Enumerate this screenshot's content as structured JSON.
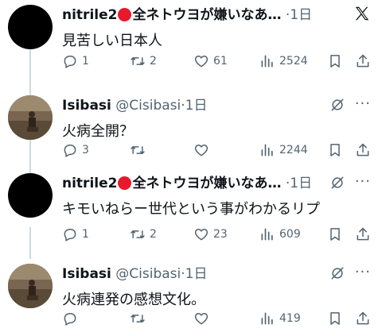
{
  "tweets": [
    {
      "name": "nitrile2",
      "name_suffix": "全ネトウヨが嫌いなあ…",
      "handle": "",
      "time": "1日",
      "text": "見苦しい日本人",
      "reply_count": "1",
      "retweet_count": "2",
      "like_count": "61",
      "view_count": "2524"
    },
    {
      "name": "Isibasi",
      "name_suffix": "",
      "handle": "@Cisibasi",
      "time": "1日",
      "text": "火病全開？",
      "reply_count": "3",
      "retweet_count": "",
      "like_count": "",
      "view_count": "2244"
    },
    {
      "name": "nitrile2",
      "name_suffix": "全ネトウヨが嫌いなあ…",
      "handle": "",
      "time": "1日",
      "text": "キモいねらー世代という事がわかるリプ",
      "reply_count": "1",
      "retweet_count": "2",
      "like_count": "23",
      "view_count": "609"
    },
    {
      "name": "Isibasi",
      "name_suffix": "",
      "handle": "@Cisibasi",
      "time": "1日",
      "text": "火病連発の感想文化。",
      "reply_count": "",
      "retweet_count": "",
      "like_count": "",
      "view_count": "419"
    }
  ],
  "separator": "·",
  "more_label": "···",
  "colors": {
    "text": "#0f1419",
    "muted": "#536471",
    "line": "#cfd9de",
    "red": "#e8192c"
  }
}
